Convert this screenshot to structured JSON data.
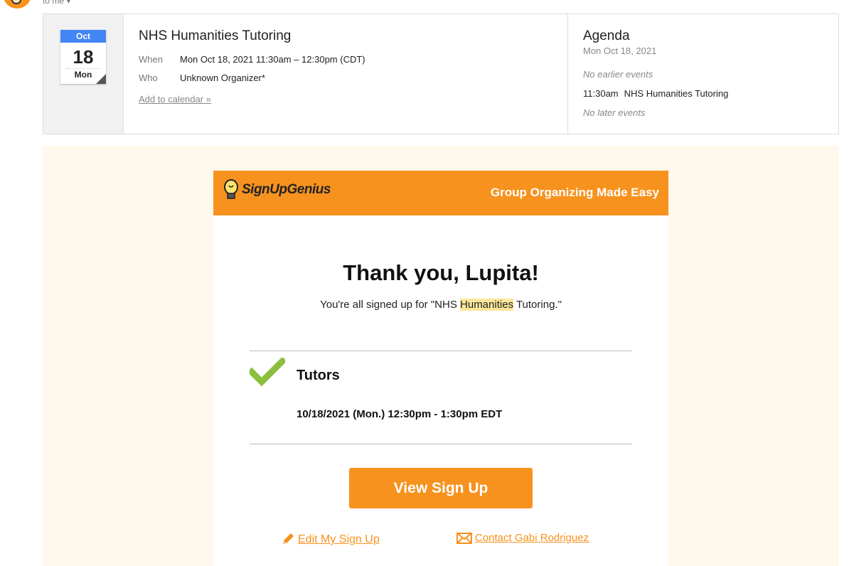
{
  "sender": {
    "to_label": "to me"
  },
  "calendar": {
    "month": "Oct",
    "day": "18",
    "weekday": "Mon",
    "event_title": "NHS Humanities Tutoring",
    "when_key": "When",
    "when_value": "Mon Oct 18, 2021 11:30am – 12:30pm (CDT)",
    "who_key": "Who",
    "who_value": "Unknown Organizer*",
    "add_link": "Add to calendar »"
  },
  "agenda": {
    "title": "Agenda",
    "date": "Mon Oct 18, 2021",
    "earlier": "No earlier events",
    "event_time": "11:30am",
    "event_name": "NHS Humanities Tutoring",
    "later": "No later events"
  },
  "email": {
    "brand": "SignUpGenius",
    "tagline": "Group Organizing Made Easy",
    "thanks": "Thank you, Lupita!",
    "signed_prefix": "You're all signed up for \"NHS ",
    "signed_highlight": "Humanities",
    "signed_suffix": " Tutoring.\"",
    "slot_title": "Tutors",
    "slot_time": "10/18/2021 (Mon.) 12:30pm - 1:30pm EDT",
    "view_button": "View Sign Up",
    "edit_link": "Edit My Sign Up",
    "contact_link": "Contact Gabi Rodriguez"
  },
  "colors": {
    "brand_orange": "#f7921e",
    "calendar_blue": "#4285f4",
    "check_green": "#8cbf3f",
    "highlight": "#fde59a",
    "email_bg": "#fff8ec"
  },
  "icons": [
    "signupgenius-logo-icon",
    "checkmark-icon",
    "pencil-icon",
    "envelope-icon",
    "chevron-down-icon"
  ]
}
